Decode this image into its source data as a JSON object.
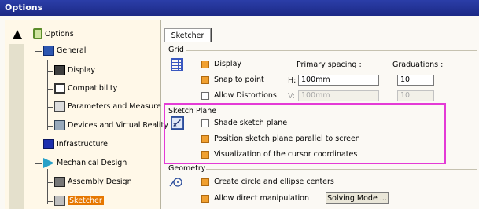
{
  "window": {
    "title": "Options"
  },
  "tree": {
    "root": "Options",
    "items": [
      {
        "label": "General"
      },
      {
        "label": "Display"
      },
      {
        "label": "Compatibility"
      },
      {
        "label": "Parameters and Measure"
      },
      {
        "label": "Devices and Virtual Reality"
      },
      {
        "label": "Infrastructure"
      },
      {
        "label": "Mechanical Design"
      },
      {
        "label": "Assembly Design"
      },
      {
        "label": "Sketcher"
      }
    ]
  },
  "tab": {
    "label": "Sketcher"
  },
  "grid": {
    "title": "Grid",
    "display_label": "Display",
    "snap_label": "Snap to point",
    "distortions_label": "Allow Distortions",
    "primary_spacing_header": "Primary spacing :",
    "graduations_header": "Graduations :",
    "h_label": "H:",
    "v_label": "V:",
    "h_spacing": "100mm",
    "v_spacing": "100mm",
    "h_graduations": "10",
    "v_graduations": "10"
  },
  "sketch_plane": {
    "title": "Sketch Plane",
    "shade_label": "Shade sketch plane",
    "position_label": "Position sketch plane parallel to screen",
    "visualization_label": "Visualization of the cursor coordinates"
  },
  "geometry": {
    "title": "Geometry",
    "centers_label": "Create circle and ellipse centers",
    "manipulation_label": "Allow direct manipulation",
    "solving_mode_label": "Solving Mode ..."
  },
  "colors": {
    "highlight": "#e43bd6",
    "checked": "#f0a030",
    "selected_tree": "#e67700",
    "title_bar": "#1c2a86"
  }
}
